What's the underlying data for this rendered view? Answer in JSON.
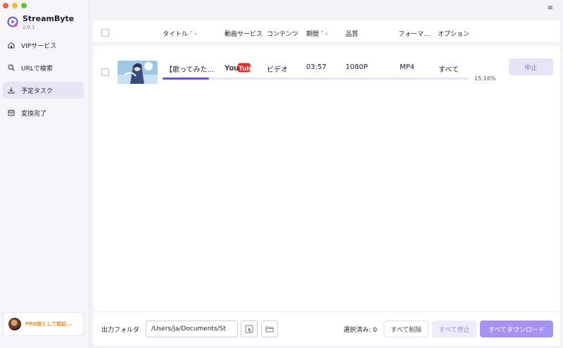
{
  "app": {
    "name": "StreamByte",
    "version": "2.0.1"
  },
  "sidebar": {
    "items": [
      {
        "label": "VIPサービス",
        "icon": "home-icon"
      },
      {
        "label": "URLで検索",
        "icon": "search-icon"
      },
      {
        "label": "予定タスク",
        "icon": "download-icon",
        "active": true
      },
      {
        "label": "変換完了",
        "icon": "archive-icon"
      }
    ],
    "promo": {
      "label": "PRO版として認証..."
    }
  },
  "topbar": {
    "menu_icon": "≡"
  },
  "table": {
    "headers": {
      "title": "タイトル",
      "service": "動画サービス",
      "content": "コンテンツ",
      "duration": "期間",
      "quality": "品質",
      "format": "フォーマ...",
      "options": "オプション"
    },
    "sort_icon": "⌃⌄",
    "rows": [
      {
        "title": "【歌ってみた...",
        "service": "YouTube",
        "content": "ビデオ",
        "duration": "03:57",
        "quality": "1080P",
        "format": "MP4",
        "option": "すべて",
        "progress": 0.1516,
        "progress_label": "15.16%",
        "action": "中止"
      }
    ]
  },
  "footer": {
    "output_label": "出力フォルダ",
    "path": "/Users/ja/Documents/St",
    "selected_label": "選択済み: 0",
    "delete_all": "すべて削除",
    "stop_all": "すべて停止",
    "download_all": "すべてダウンロード"
  },
  "colors": {
    "accent": "#6a4ee0",
    "accent_light": "#e7e4f8",
    "promo": "#ef8a2a",
    "youtube_red": "#e52d27"
  }
}
